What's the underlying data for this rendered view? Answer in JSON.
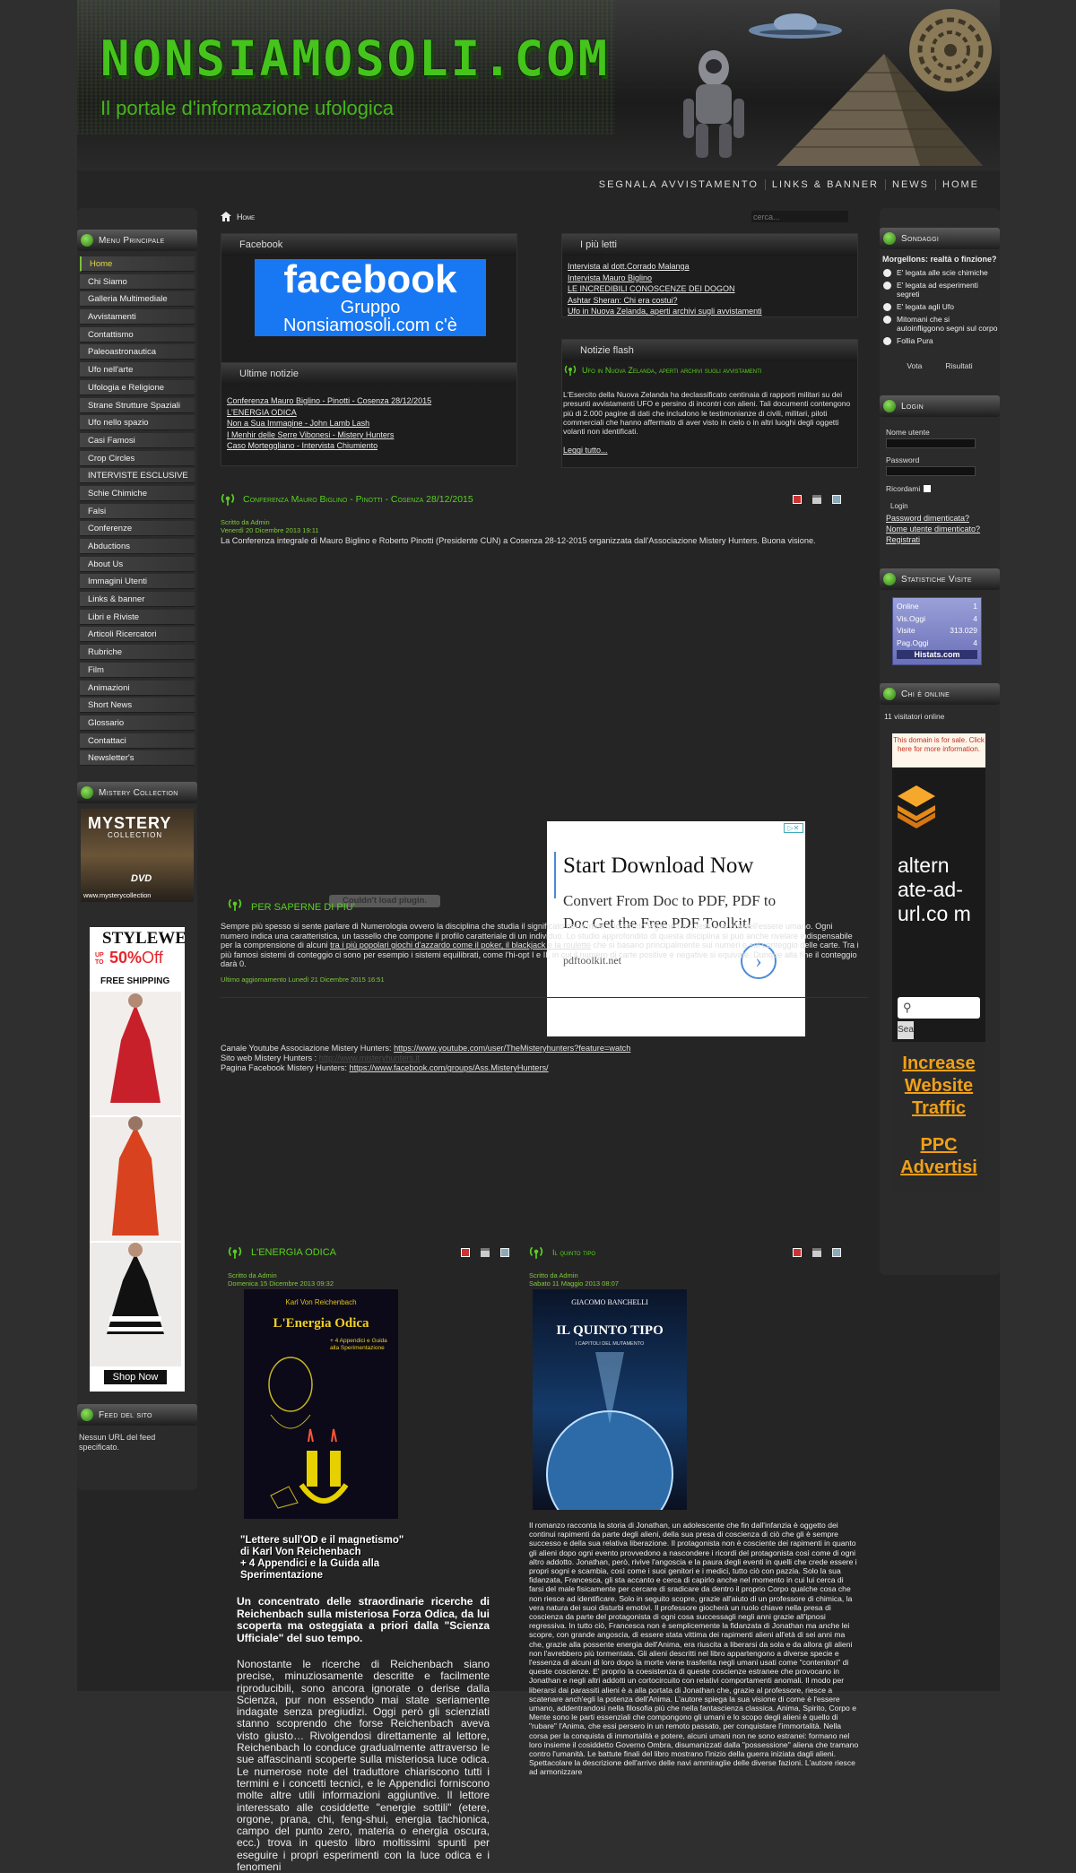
{
  "header": {
    "logo": "NONSIAMOSOLI.COM",
    "tagline": "Il portale d'informazione ufologica"
  },
  "topnav": [
    "SEGNALA AVVISTAMENTO",
    "LINKS & BANNER",
    "NEWS",
    "HOME"
  ],
  "breadcrumb": {
    "home": "Home",
    "search_placeholder": "cerca..."
  },
  "left": {
    "menu_title": "Menu Principale",
    "menu": [
      "Home",
      "Chi Siamo",
      "Galleria Multimediale",
      "Avvistamenti",
      "Contattismo",
      "Paleoastronautica",
      "Ufo nell'arte",
      "Ufologia e Religione",
      "Strane Strutture Spaziali",
      "Ufo nello spazio",
      "Casi Famosi",
      "Crop Circles",
      "INTERVISTE ESCLUSIVE",
      "Schie Chimiche",
      "Falsi",
      "Conferenze",
      "Abductions",
      "About Us",
      "Immagini Utenti",
      "Links & banner",
      "Libri e Riviste",
      "Articoli Ricercatori",
      "Rubriche",
      "Film",
      "Animazioni",
      "Short News",
      "Glossario",
      "Contattaci",
      "Newsletter's"
    ],
    "mystery_title": "Mistery Collection",
    "mystery_banner": {
      "top": "MYSTERY",
      "sub": "COLLECTION",
      "dvd": "DVD",
      "url": "www.mysterycollection"
    },
    "style_ad": {
      "brand": "STYLEWE",
      "up_to": "UP TO",
      "percent": "50%",
      "off": "Off",
      "shipping": "FREE SHIPPING",
      "shop": "Shop Now"
    },
    "feed_title": "Feed del sito",
    "feed_text": "Nessun URL del feed specificato."
  },
  "facebook_box": {
    "title": "Facebook",
    "logo": "facebook",
    "line1": "Gruppo",
    "line2": "Nonsiamosoli.com c'è"
  },
  "piu_letti": {
    "title": "I più letti",
    "items": [
      "Intervista al dott.Corrado Malanga",
      "Intervista Mauro Biglino",
      "LE INCREDIBILI CONOSCENZE DEI DOGON",
      "Ashtar Sheran: Chi era costui?",
      "Ufo in Nuova Zelanda, aperti archivi sugli avvistamenti"
    ]
  },
  "ultime": {
    "title": "Ultime notizie",
    "items": [
      "Conferenza Mauro Biglino - Pinotti - Cosenza 28/12/2015",
      "L'ENERGIA ODICA",
      "Non a Sua Immagine - John Lamb Lash",
      "I Menhir delle Serre Vibonesi - Mistery Hunters",
      "Caso Morteggliano - Intervista Chiumiento"
    ]
  },
  "flash": {
    "title": "Notizie flash",
    "headline": "Ufo in Nuova Zelanda, aperti archivi sugli avvistamenti",
    "body": "L'Esercito della Nuova Zelanda ha declassificato centinaia di rapporti militari su dei presunti avvistamenti UFO e persino di incontri con alieni. Tali documenti contengono più di 2.000 pagine di dati che includono le testimonianze di civili, militari, piloti commerciali che hanno affermato di aver visto in cielo o in altri luoghi degli oggetti volanti non identificati.",
    "more": "Leggi tutto..."
  },
  "article1": {
    "title": "Conferenza Mauro Biglino - Pinotti - Cosenza 28/12/2015",
    "author": "Scritto da Admin",
    "date": "Venerdì 20 Dicembre 2013 19:11",
    "intro": "La Conferenza integrale di Mauro Biglino e Roberto Pinotti (Presidente CUN) a Cosenza 28-12-2015 organizzata dall'Associazione Mistery Hunters. Buona visione.",
    "plugin": "Couldn't load plugin.",
    "ad": {
      "title": "Start Download Now",
      "body": "Convert From Doc to PDF, PDF to Doc Get the Free PDF Toolkit!",
      "domain": "pdftoolkit.net"
    },
    "l1": "Canale Youtube Associazione Mistery Hunters: ",
    "l1u": "https://www.youtube.com/user/TheMisteryhunters?feature=watch",
    "l2": "Sito web Mistery Hunters : ",
    "l2u": "http://www.misteryhunters.it",
    "l3": "Pagina Facebook Mistery Hunters: ",
    "l3u": "https://www.facebook.com/groups/Ass.MisteryHunters/"
  },
  "article2": {
    "title": "PER SAPERNE DI PIU'",
    "body1": "Sempre più spesso si sente parlare di Numerologia ovvero la disciplina che studia il significato dei numeri e lo stretto legame tra questi e la vita dell'essere umano. Ogni numero indica una caratteristica, un tassello che compone il profilo caratteriale di un individuo. Lo studio approfondito di questa disciplina si può anche rivelare indispensabile per la comprensione di alcuni ",
    "link": "tra i più popolari giochi d'azzardo come il poker, il blackjack e la roulette",
    "body2": " che si basano principalmente sui numeri e sul conteggio delle carte. Tra i più famosi sistemi di conteggio ci sono per esempio i sistemi equilibrati, come l'hi-opt I e II, in cui il numero di carte positive e negative si equivale. Dunque alla fine il conteggio darà 0.",
    "updated": "Ultimo aggiornamento Lunedì 21 Dicembre 2015 16:51"
  },
  "article3": {
    "title": "L'ENERGIA ODICA",
    "author": "Scritto da Admin",
    "date": "Domenica 15 Dicembre 2013 09:32",
    "cover": {
      "author": "Karl Von Reichenbach",
      "title": "L'Energia Odica",
      "sub": "+ 4 Appendici e Guida alla Sperimentazione"
    },
    "quote": "\"Lettere sull'OD e il magnetismo\"",
    "quote2": "di Karl Von Reichenbach",
    "quote3": "+ 4 Appendici e la Guida alla",
    "quote4": "Sperimentazione",
    "lead": "Un concentrato delle straordinarie ricerche di Reichenbach sulla misteriosa Forza Odica, da lui scoperta ma osteggiata a priori dalla \"Scienza Ufficiale\" del suo tempo.",
    "body": "Nonostante le ricerche di Reichenbach siano precise, minuziosamente descritte e facilmente riproducibili, sono ancora ignorate o derise dalla Scienza, pur non essendo mai state seriamente indagate senza pregiudizi. Oggi però gli scienziati stanno scoprendo che forse Reichenbach aveva visto giusto… Rivolgendosi direttamente al lettore, Reichenbach lo conduce gradualmente attraverso le sue affascinanti scoperte sulla misteriosa luce odica. Le numerose note del traduttore chiariscono tutti i termini e i concetti tecnici, e le Appendici forniscono molte altre utili informazioni aggiuntive. Il lettore interessato alle cosiddette \"energie sottili\" (etere, orgone, prana, chi, feng-shui, energia tachionica, campo del punto zero, materia o energia oscura, ecc.) trova in questo libro moltissimi spunti per eseguire i propri esperimenti con la luce odica e i fenomeni"
  },
  "article4": {
    "title": "Il quinto tipo",
    "author": "Scritto da Admin",
    "date": "Sabato 11 Maggio 2013 08:07",
    "cover": {
      "author": "GIACOMO BANCHELLI",
      "title": "IL QUINTO TIPO",
      "sub": "I CAPITOLI DEL MUTAMENTO"
    },
    "body": "Il romanzo racconta la storia di Jonathan, un adolescente che fin dall'infanzia è oggetto dei continui rapimenti da parte degli alieni, della sua presa di coscienza di ciò che gli è sempre successo e della sua relativa liberazione. Il protagonista non è cosciente dei rapimenti in quanto gli alieni dopo ogni evento provvedono a nascondere i ricordi del protagonista così come di ogni altro addotto. Jonathan, però, rivive l'angoscia e la paura degli eventi in quelli che crede essere i propri sogni e scambia, così come i suoi genitori e i medici, tutto ciò con pazzia. Solo la sua fidanzata, Francesca, gli sta accanto e cerca di capirlo anche nel momento in cui lui cerca di farsi del male fisicamente per cercare di sradicare da dentro il proprio Corpo qualche cosa che non riesce ad identificare. Solo in seguito scopre, grazie all'aiuto di un professore di chimica, la vera natura dei suoi disturbi emotivi. Il professore giocherà un ruolo chiave nella presa di coscienza da parte del protagonista di ogni cosa successagli negli anni grazie all'ipnosi regressiva. In tutto ciò, Francesca non è semplicemente la fidanzata di Jonathan ma anche lei scopre, con grande angoscia, di essere stata vittima dei rapimenti alieni all'età di sei anni ma che, grazie alla possente energia dell'Anima, era riuscita a liberarsi da sola e da allora gli alieni non l'avrebbero più tormentata. Gli alieni descritti nel libro appartengono a diverse specie e l'essenza di alcuni di loro dopo la morte viene trasferita negli umani usati come \"contenitori\" di queste coscienze. E' proprio la coesistenza di queste coscienze estranee che provocano in Jonathan e negli altri addotti un cortocircuito con relativi comportamenti anomali. Il modo per liberarsi dai parassiti alieni è a alla portata di Jonathan che, grazie al professore, riesce a scatenare anch'egli la potenza dell'Anima. L'autore spiega la sua visione di come è l'essere umano, addentrandosi nella filosofia più che nella fantascienza classica. Anima, Spirito, Corpo e Mente sono le parti essenziali che compongono gli umani e lo scopo degli alieni è quello di \"rubare\" l'Anima, che essi persero in un remoto passato, per conquistare l'immortalità. Nella corsa per la conquista di immortalità e potere, alcuni umani non ne sono estranei: formano nel loro insieme il cosiddetto Governo Ombra, disumanizzati dalla \"possessione\" aliena che tramano contro l'umanità. Le battute finali del libro mostrano l'inizio della guerra iniziata dagli alieni. Spettacolare la descrizione dell'arrivo delle navi ammiraglie delle diverse fazioni. L'autore riesce ad armonizzare"
  },
  "right": {
    "poll_title": "Sondaggi",
    "poll_q": "Morgellons: realtà o finzione?",
    "poll_opts": [
      "E' legata alle scie chimiche",
      "E' legata ad esperimenti segreti",
      "E' legata agli Ufo",
      "Mitomani che si autoinfliggono segni sul corpo",
      "Follia Pura"
    ],
    "vote": "Vota",
    "results": "Risultati",
    "login_title": "Login",
    "user": "Nome utente",
    "pass": "Password",
    "remember": "Ricordami",
    "login_btn": "Login",
    "forgot_pw": "Password dimenticata?",
    "forgot_user": "Nome utente dimenticato?",
    "register": "Registrati",
    "stats_title": "Statistiche Visite",
    "stats": [
      {
        "k": "Online",
        "v": "1"
      },
      {
        "k": "Vis.Oggi",
        "v": "4"
      },
      {
        "k": "Visite",
        "v": "313.029"
      },
      {
        "k": "Pag.Oggi",
        "v": "4"
      }
    ],
    "stats_brand": "Histats.com",
    "online_title": "Chi è online",
    "online_text": "11 visitatori online",
    "sale": "This domain is for sale. Click here for more information.",
    "alt_domain": "altern ate-ad-url.co m",
    "sea": "Sea",
    "increase": "Increase Website Traffic",
    "ppc": "PPC Advertisi"
  }
}
